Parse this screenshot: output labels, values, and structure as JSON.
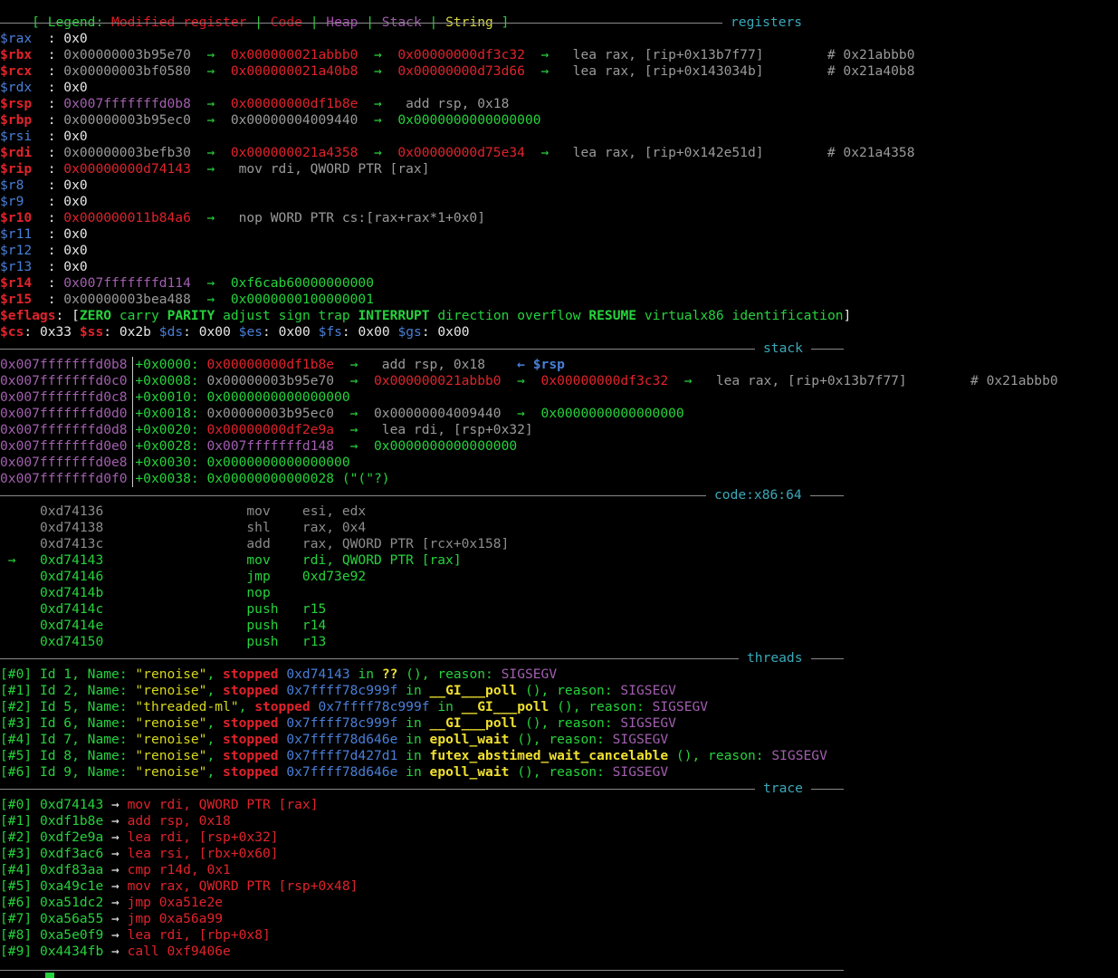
{
  "legend": {
    "open": "[ Legend: ",
    "modified": "Modified register",
    "code": "Code",
    "heap": "Heap",
    "stack": "Stack",
    "string": "String",
    "pipe": " | ",
    "close": " ]"
  },
  "sections": {
    "registers": "registers",
    "stack": "stack",
    "code": "code:x86:64",
    "threads": "threads",
    "trace": "trace"
  },
  "registers": [
    {
      "name": "$rax",
      "modified": false,
      "parts": [
        {
          "t": "0x0",
          "c": "wht"
        }
      ]
    },
    {
      "name": "$rbx",
      "modified": true,
      "parts": [
        {
          "t": "0x00000003b95e70",
          "c": "gray"
        },
        {
          "t": "0x000000021abbb0",
          "c": "red"
        },
        {
          "t": "0x00000000df3c32",
          "c": "red"
        },
        {
          "t": "lea rax, [rip+0x13b7f77]        # 0x21abbb0",
          "c": "gray",
          "pad": true
        }
      ]
    },
    {
      "name": "$rcx",
      "modified": true,
      "parts": [
        {
          "t": "0x00000003bf0580",
          "c": "gray"
        },
        {
          "t": "0x000000021a40b8",
          "c": "red"
        },
        {
          "t": "0x00000000d73d66",
          "c": "red"
        },
        {
          "t": "lea rax, [rip+0x143034b]        # 0x21a40b8",
          "c": "gray",
          "pad": true
        }
      ]
    },
    {
      "name": "$rdx",
      "modified": false,
      "parts": [
        {
          "t": "0x0",
          "c": "wht"
        }
      ]
    },
    {
      "name": "$rsp",
      "modified": true,
      "parts": [
        {
          "t": "0x007fffffffd0b8",
          "c": "tid"
        },
        {
          "t": "0x00000000df1b8e",
          "c": "red"
        },
        {
          "t": "add rsp, 0x18",
          "c": "gray",
          "pad": true
        }
      ]
    },
    {
      "name": "$rbp",
      "modified": true,
      "parts": [
        {
          "t": "0x00000003b95ec0",
          "c": "gray"
        },
        {
          "t": "0x00000004009440",
          "c": "gray"
        },
        {
          "t": "0x0000000000000000",
          "c": "grn"
        }
      ]
    },
    {
      "name": "$rsi",
      "modified": false,
      "parts": [
        {
          "t": "0x0",
          "c": "wht"
        }
      ]
    },
    {
      "name": "$rdi",
      "modified": true,
      "parts": [
        {
          "t": "0x00000003befb30",
          "c": "gray"
        },
        {
          "t": "0x000000021a4358",
          "c": "red"
        },
        {
          "t": "0x00000000d75e34",
          "c": "red"
        },
        {
          "t": "lea rax, [rip+0x142e51d]        # 0x21a4358",
          "c": "gray",
          "pad": true
        }
      ]
    },
    {
      "name": "$rip",
      "modified": true,
      "parts": [
        {
          "t": "0x00000000d74143",
          "c": "red"
        },
        {
          "t": "mov rdi, QWORD PTR [rax]",
          "c": "gray",
          "pad": true
        }
      ]
    },
    {
      "name": "$r8",
      "modified": false,
      "parts": [
        {
          "t": "0x0",
          "c": "wht"
        }
      ]
    },
    {
      "name": "$r9",
      "modified": false,
      "parts": [
        {
          "t": "0x0",
          "c": "wht"
        }
      ]
    },
    {
      "name": "$r10",
      "modified": true,
      "parts": [
        {
          "t": "0x000000011b84a6",
          "c": "red"
        },
        {
          "t": "nop WORD PTR cs:[rax+rax*1+0x0]",
          "c": "gray",
          "pad": true
        }
      ]
    },
    {
      "name": "$r11",
      "modified": false,
      "parts": [
        {
          "t": "0x0",
          "c": "wht"
        }
      ]
    },
    {
      "name": "$r12",
      "modified": false,
      "parts": [
        {
          "t": "0x0",
          "c": "wht"
        }
      ]
    },
    {
      "name": "$r13",
      "modified": false,
      "parts": [
        {
          "t": "0x0",
          "c": "wht"
        }
      ]
    },
    {
      "name": "$r14",
      "modified": true,
      "parts": [
        {
          "t": "0x007fffffffd114",
          "c": "tid"
        },
        {
          "t": "0xf6cab60000000000",
          "c": "grn"
        }
      ]
    },
    {
      "name": "$r15",
      "modified": true,
      "parts": [
        {
          "t": "0x00000003bea488",
          "c": "gray"
        },
        {
          "t": "0x0000000100000001",
          "c": "grn"
        }
      ]
    }
  ],
  "eflags": {
    "name": "$eflags",
    "flags": [
      {
        "t": "ZERO",
        "on": true
      },
      {
        "t": "carry",
        "on": false
      },
      {
        "t": "PARITY",
        "on": true
      },
      {
        "t": "adjust",
        "on": false
      },
      {
        "t": "sign",
        "on": false
      },
      {
        "t": "trap",
        "on": false
      },
      {
        "t": "INTERRUPT",
        "on": true
      },
      {
        "t": "direction",
        "on": false
      },
      {
        "t": "overflow",
        "on": false
      },
      {
        "t": "RESUME",
        "on": true
      },
      {
        "t": "virtualx86",
        "on": false
      },
      {
        "t": "identification",
        "on": false
      }
    ]
  },
  "segments": [
    {
      "n": "$cs",
      "v": "0x33"
    },
    {
      "n": "$ss",
      "v": "0x2b"
    },
    {
      "n": "$ds",
      "v": "0x00"
    },
    {
      "n": "$es",
      "v": "0x00"
    },
    {
      "n": "$fs",
      "v": "0x00"
    },
    {
      "n": "$gs",
      "v": "0x00"
    }
  ],
  "stack": [
    {
      "addr": "0x007fffffffd0b8",
      "off": "+0x0000: ",
      "parts": [
        {
          "t": "0x00000000df1b8e",
          "c": "red"
        },
        {
          "t": "add rsp, 0x18",
          "c": "gray",
          "pad": true
        }
      ],
      "tag": "← $rsp"
    },
    {
      "addr": "0x007fffffffd0c0",
      "off": "+0x0008: ",
      "parts": [
        {
          "t": "0x00000003b95e70",
          "c": "gray"
        },
        {
          "t": "0x000000021abbb0",
          "c": "red"
        },
        {
          "t": "0x00000000df3c32",
          "c": "red"
        },
        {
          "t": "lea rax, [rip+0x13b7f77]        # 0x21abbb0",
          "c": "gray",
          "pad": true
        }
      ]
    },
    {
      "addr": "0x007fffffffd0c8",
      "off": "+0x0010: ",
      "parts": [
        {
          "t": "0x0000000000000000",
          "c": "grn"
        }
      ]
    },
    {
      "addr": "0x007fffffffd0d0",
      "off": "+0x0018: ",
      "parts": [
        {
          "t": "0x00000003b95ec0",
          "c": "gray"
        },
        {
          "t": "0x00000004009440",
          "c": "gray"
        },
        {
          "t": "0x0000000000000000",
          "c": "grn"
        }
      ]
    },
    {
      "addr": "0x007fffffffd0d8",
      "off": "+0x0020: ",
      "parts": [
        {
          "t": "0x00000000df2e9a",
          "c": "red"
        },
        {
          "t": "lea rdi, [rsp+0x32]",
          "c": "gray",
          "pad": true
        }
      ]
    },
    {
      "addr": "0x007fffffffd0e0",
      "off": "+0x0028: ",
      "parts": [
        {
          "t": "0x007fffffffd148",
          "c": "tid"
        },
        {
          "t": "0x0000000000000000",
          "c": "grn"
        }
      ]
    },
    {
      "addr": "0x007fffffffd0e8",
      "off": "+0x0030: ",
      "parts": [
        {
          "t": "0x0000000000000000",
          "c": "grn"
        }
      ]
    },
    {
      "addr": "0x007fffffffd0f0",
      "off": "+0x0038: ",
      "parts": [
        {
          "t": "0x00000000000028 (\"(\"?)",
          "c": "grn"
        }
      ]
    }
  ],
  "code": [
    {
      "cur": false,
      "addr": "0xd74136",
      "mn": "mov",
      "ops": "esi, edx",
      "past": true
    },
    {
      "cur": false,
      "addr": "0xd74138",
      "mn": "shl",
      "ops": "rax, 0x4",
      "past": true
    },
    {
      "cur": false,
      "addr": "0xd7413c",
      "mn": "add",
      "ops": "rax, QWORD PTR [rcx+0x158]",
      "past": true
    },
    {
      "cur": true,
      "addr": "0xd74143",
      "mn": "mov",
      "ops": "rdi, QWORD PTR [rax]",
      "past": false
    },
    {
      "cur": false,
      "addr": "0xd74146",
      "mn": "jmp",
      "ops": "0xd73e92",
      "past": false
    },
    {
      "cur": false,
      "addr": "0xd7414b",
      "mn": "nop",
      "ops": "",
      "past": false
    },
    {
      "cur": false,
      "addr": "0xd7414c",
      "mn": "push",
      "ops": "r15",
      "past": false
    },
    {
      "cur": false,
      "addr": "0xd7414e",
      "mn": "push",
      "ops": "r14",
      "past": false
    },
    {
      "cur": false,
      "addr": "0xd74150",
      "mn": "push",
      "ops": "r13",
      "past": false
    }
  ],
  "code_arrow": "→",
  "threads": [
    {
      "idx": "[#0]",
      "id": "Id 1, Name: ",
      "name": "\"renoise\"",
      "state": "stopped",
      "addr": "0xd74143",
      "fn": "??",
      "fnstyle": "yel",
      "reason": "SIGSEGV"
    },
    {
      "idx": "[#1]",
      "id": "Id 2, Name: ",
      "name": "\"renoise\"",
      "state": "stopped",
      "addr": "0x7ffff78c999f",
      "fn": "__GI___poll",
      "fnstyle": "yel",
      "reason": "SIGSEGV"
    },
    {
      "idx": "[#2]",
      "id": "Id 5, Name: ",
      "name": "\"threaded-ml\"",
      "state": "stopped",
      "addr": "0x7ffff78c999f",
      "fn": "__GI___poll",
      "fnstyle": "yel",
      "reason": "SIGSEGV"
    },
    {
      "idx": "[#3]",
      "id": "Id 6, Name: ",
      "name": "\"renoise\"",
      "state": "stopped",
      "addr": "0x7ffff78c999f",
      "fn": "__GI___poll",
      "fnstyle": "yel",
      "reason": "SIGSEGV"
    },
    {
      "idx": "[#4]",
      "id": "Id 7, Name: ",
      "name": "\"renoise\"",
      "state": "stopped",
      "addr": "0x7ffff78d646e",
      "fn": "epoll_wait",
      "fnstyle": "yel",
      "reason": "SIGSEGV"
    },
    {
      "idx": "[#5]",
      "id": "Id 8, Name: ",
      "name": "\"renoise\"",
      "state": "stopped",
      "addr": "0x7ffff7d427d1",
      "fn": "futex_abstimed_wait_cancelable",
      "fnstyle": "yel",
      "reason": "SIGSEGV"
    },
    {
      "idx": "[#6]",
      "id": "Id 9, Name: ",
      "name": "\"renoise\"",
      "state": "stopped",
      "addr": "0x7ffff78d646e",
      "fn": "epoll_wait",
      "fnstyle": "yel",
      "reason": "SIGSEGV"
    }
  ],
  "thread_words": {
    "in": " in ",
    "reason": " (), reason: "
  },
  "trace": [
    {
      "idx": "[#0]",
      "addr": "0xd74143",
      "ins": "mov rdi, QWORD PTR [rax]"
    },
    {
      "idx": "[#1]",
      "addr": "0xdf1b8e",
      "ins": "add rsp, 0x18"
    },
    {
      "idx": "[#2]",
      "addr": "0xdf2e9a",
      "ins": "lea rdi, [rsp+0x32]"
    },
    {
      "idx": "[#3]",
      "addr": "0xdf3ac6",
      "ins": "lea rsi, [rbx+0x60]"
    },
    {
      "idx": "[#4]",
      "addr": "0xdf83aa",
      "ins": "cmp r14d, 0x1"
    },
    {
      "idx": "[#5]",
      "addr": "0xa49c1e",
      "ins": "mov rax, QWORD PTR [rsp+0x48]"
    },
    {
      "idx": "[#6]",
      "addr": "0xa51dc2",
      "ins": "jmp 0xa51e2e"
    },
    {
      "idx": "[#7]",
      "addr": "0xa56a55",
      "ins": "jmp 0xa56a99"
    },
    {
      "idx": "[#8]",
      "addr": "0xa5e0f9",
      "ins": "lea rdi, [rbp+0x8]"
    },
    {
      "idx": "[#9]",
      "addr": "0x4434fb",
      "ins": "call 0xf9406e"
    }
  ],
  "arrow": "→",
  "colors": {
    "modified": "#e01b24",
    "code": "#c01c28",
    "heap": "#a94cb3",
    "stack": "#9e5ca8",
    "string": "#d8d84a",
    "green": "#26d23c",
    "blue": "#4a7fd8"
  }
}
